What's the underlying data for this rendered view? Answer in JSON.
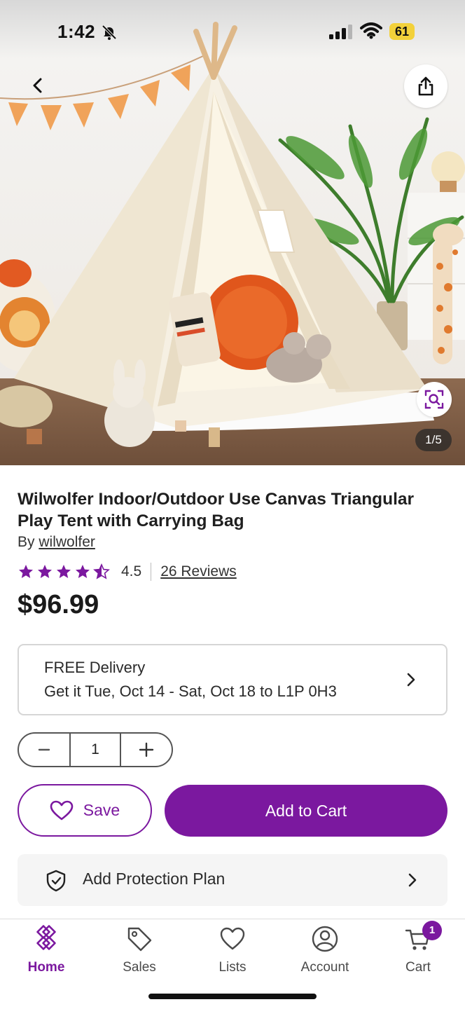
{
  "status_bar": {
    "time": "1:42",
    "battery": "61"
  },
  "gallery": {
    "counter": "1/5"
  },
  "product": {
    "title": "Wilwolfer Indoor/Outdoor Use Canvas Triangular Play Tent with Carrying Bag",
    "by_prefix": "By",
    "brand": "wilwolfer",
    "rating": "4.5",
    "stars_filled": 4.5,
    "stars_total": 5,
    "reviews": "26 Reviews",
    "price": "$96.99"
  },
  "delivery": {
    "title": "FREE Delivery",
    "date": "Get it Tue, Oct 14 - Sat, Oct 18 to L1P 0H3"
  },
  "quantity": {
    "value": "1"
  },
  "actions": {
    "save_label": "Save",
    "add_to_cart_label": "Add to Cart"
  },
  "protection": {
    "label": "Add Protection Plan"
  },
  "tabbar": {
    "items": [
      {
        "label": "Home",
        "icon": "home-icon",
        "active": true
      },
      {
        "label": "Sales",
        "icon": "tag-icon",
        "active": false
      },
      {
        "label": "Lists",
        "icon": "heart-icon",
        "active": false
      },
      {
        "label": "Account",
        "icon": "account-icon",
        "active": false
      },
      {
        "label": "Cart",
        "icon": "cart-icon",
        "active": false
      }
    ],
    "cart_badge": "1"
  },
  "colors": {
    "brand_purple": "#7b189f",
    "star_purple": "#7b189f"
  }
}
